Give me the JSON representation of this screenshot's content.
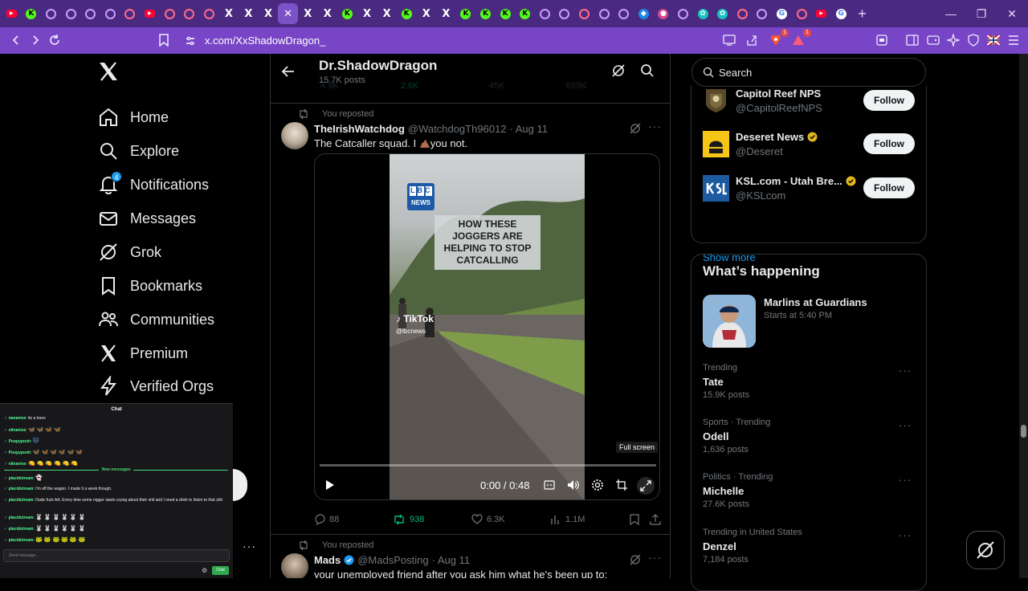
{
  "browser": {
    "tabs": [
      {
        "icon": "youtube-icon",
        "kind": "yt"
      },
      {
        "icon": "kick-icon",
        "kind": "kick"
      },
      {
        "icon": "twitch-icon",
        "kind": "ring"
      },
      {
        "icon": "twitch-icon",
        "kind": "ring"
      },
      {
        "icon": "twitch-icon",
        "kind": "ring"
      },
      {
        "icon": "twitch-icon",
        "kind": "ring"
      },
      {
        "icon": "stream-icon",
        "kind": "ringr"
      },
      {
        "icon": "youtube-icon",
        "kind": "yt"
      },
      {
        "icon": "stream-icon",
        "kind": "ringr"
      },
      {
        "icon": "stream-icon",
        "kind": "ringr"
      },
      {
        "icon": "stream-icon",
        "kind": "ringr"
      },
      {
        "icon": "x-icon",
        "kind": "x"
      },
      {
        "icon": "x-icon",
        "kind": "x"
      },
      {
        "icon": "x-icon",
        "kind": "x"
      },
      {
        "icon": "close-icon",
        "kind": "x",
        "active": true
      },
      {
        "icon": "x-icon",
        "kind": "x"
      },
      {
        "icon": "x-icon",
        "kind": "x"
      },
      {
        "icon": "kick-icon",
        "kind": "kick"
      },
      {
        "icon": "x-icon",
        "kind": "x"
      },
      {
        "icon": "x-icon",
        "kind": "x"
      },
      {
        "icon": "kick-icon",
        "kind": "kick"
      },
      {
        "icon": "x-icon",
        "kind": "x"
      },
      {
        "icon": "x-icon",
        "kind": "x"
      },
      {
        "icon": "kick-icon",
        "kind": "kick"
      },
      {
        "icon": "kick-icon",
        "kind": "kick"
      },
      {
        "icon": "kick-icon",
        "kind": "kick"
      },
      {
        "icon": "kick-icon",
        "kind": "kick"
      },
      {
        "icon": "twitch-icon",
        "kind": "ring"
      },
      {
        "icon": "loading-icon",
        "kind": "ring"
      },
      {
        "icon": "stream-icon",
        "kind": "ringr"
      },
      {
        "icon": "twitch-icon",
        "kind": "ring"
      },
      {
        "icon": "twitch-icon",
        "kind": "ring"
      },
      {
        "icon": "app-icon",
        "kind": "blue"
      },
      {
        "icon": "stream-icon",
        "kind": "mag"
      },
      {
        "icon": "stream-icon",
        "kind": "ring"
      },
      {
        "icon": "app-icon",
        "kind": "teal"
      },
      {
        "icon": "app-icon",
        "kind": "teal"
      },
      {
        "icon": "stream-icon",
        "kind": "ringr"
      },
      {
        "icon": "twitch-icon",
        "kind": "ring"
      },
      {
        "icon": "google-icon",
        "kind": "g"
      },
      {
        "icon": "stream-icon",
        "kind": "ringr"
      },
      {
        "icon": "youtube-icon",
        "kind": "yt"
      },
      {
        "icon": "google-icon",
        "kind": "g"
      }
    ],
    "url": "x.com/XxShadowDragon_",
    "brave_badge": "1",
    "rewards_badge": "1"
  },
  "nav": {
    "items": [
      {
        "label": "Home",
        "icon": "home-icon"
      },
      {
        "label": "Explore",
        "icon": "search-icon"
      },
      {
        "label": "Notifications",
        "icon": "bell-icon",
        "badge": "4"
      },
      {
        "label": "Messages",
        "icon": "envelope-icon"
      },
      {
        "label": "Grok",
        "icon": "grok-icon"
      },
      {
        "label": "Bookmarks",
        "icon": "bookmark-icon"
      },
      {
        "label": "Communities",
        "icon": "communities-icon"
      },
      {
        "label": "Premium",
        "icon": "x-icon"
      },
      {
        "label": "Verified Orgs",
        "icon": "lightning-icon"
      }
    ]
  },
  "header": {
    "name": "Dr.ShadowDragon",
    "posts": "15.7K posts",
    "ghost": {
      "reply": "4.9K",
      "repost": "2.6K",
      "like": "45K",
      "views": "669K"
    }
  },
  "post1": {
    "repost_label": "You reposted",
    "name": "TheIrishWatchdog",
    "handle": "@WatchdogTh96012",
    "date": "· Aug 11",
    "text_a": "The Catcaller squad.  I ",
    "text_b": "you not.",
    "video": {
      "news_logo": "LBC",
      "news_sub": "NEWS",
      "headline": "HOW THESE JOGGERS ARE HELPING TO STOP CATCALLING",
      "watermark": "TikTok",
      "watermark_handle": "@lbcnews",
      "tooltip": "Full screen",
      "time": "0:00 / 0:48",
      "progress": 0
    },
    "stats": {
      "replies": "88",
      "reposts": "938",
      "likes": "6.3K",
      "views": "1.1M"
    }
  },
  "post2": {
    "repost_label": "You reposted",
    "name": "Mads",
    "handle": "@MadsPosting",
    "date": "· Aug 11",
    "text": "your unemployed friend after you ask him what he's been up to:"
  },
  "right": {
    "search_placeholder": "Search",
    "follow": [
      {
        "name": "Capitol Reef NPS",
        "handle": "@CapitolReefNPS",
        "button": "Follow",
        "verified": false
      },
      {
        "name": "Deseret News",
        "handle": "@Deseret",
        "button": "Follow",
        "verified": true
      },
      {
        "name": "KSL.com - Utah Bre...",
        "handle": "@KSLcom",
        "button": "Follow",
        "verified": true
      }
    ],
    "show_more": "Show more",
    "happening_title": "What’s happening",
    "event": {
      "title": "Marlins at Guardians",
      "time": "Starts at 5:40 PM"
    },
    "trends": [
      {
        "meta": "Trending",
        "name": "Tate",
        "posts": "15.9K posts"
      },
      {
        "meta": "Sports · Trending",
        "name": "Odell",
        "posts": "1,636 posts"
      },
      {
        "meta": "Politics · Trending",
        "name": "Michelle",
        "posts": "27.6K posts"
      },
      {
        "meta": "Trending in United States",
        "name": "Denzel",
        "posts": "7,184 posts"
      }
    ]
  },
  "chat": {
    "title": "Chat",
    "lines": [
      {
        "user": "nananise",
        "msg": " its a trans"
      },
      {
        "user": "nilnanise",
        "msg": "",
        "emo": "🦋 🦋 🦋 🦋"
      },
      {
        "user": "Poopypooh",
        "msg": "",
        "emo": "🐱"
      },
      {
        "user": "Poopypooh",
        "msg": "",
        "emo": "🦋 🦋 🦋 🦋 🦋 🦋"
      },
      {
        "user": "nilnanise",
        "msg": "",
        "emo": "🍋 🍋 🍋 🍋 🍋 🍋"
      }
    ],
    "new_messages": "New messages",
    "lines2": [
      {
        "user": "placidstream",
        "msg": "",
        "emo": "👻"
      },
      {
        "user": "placidstream",
        "msg": " I'm off the wagon. I made it a week though."
      },
      {
        "user": "placidstream",
        "msg": " Dude fuck AA. Every time some nigger starts crying about their shit and I need a drink to listen to that shit"
      },
      {
        "user": "placidstream",
        "msg": "",
        "emo": "🐰 🐰 🐰 🐰 🐰 🐰"
      },
      {
        "user": "placidstream",
        "msg": "",
        "emo": "🐰 🐰 🐰 🐰 🐰 🐰"
      },
      {
        "user": "placidstream",
        "msg": "",
        "emo": "🐸 🐸 🐸 🐸 🐸 🐸"
      }
    ],
    "input_placeholder": "Send message...",
    "send": "Chat"
  }
}
